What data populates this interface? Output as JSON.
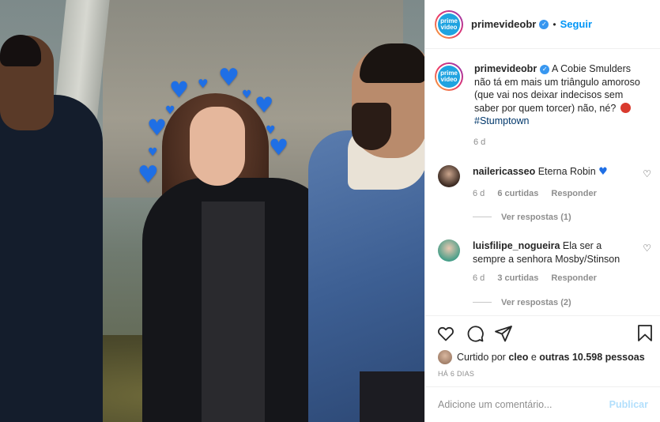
{
  "post": {
    "username": "primevideobr",
    "follow_label": "Seguir",
    "avatar_text_line1": "prime",
    "avatar_text_line2": "video"
  },
  "caption": {
    "username": "primevideobr",
    "text": "A Cobie Smulders não tá em mais um triângulo amoroso (que vai nos deixar indecisos sem saber por quem torcer) não, né?",
    "hashtag": "#Stumptown",
    "time": "6 d"
  },
  "comments": [
    {
      "username": "nailericasseo",
      "text": "Eterna Robin",
      "time": "6 d",
      "likes": "6 curtidas",
      "reply_label": "Responder",
      "view_replies": "Ver respostas (1)"
    },
    {
      "username": "luisfilipe_nogueira",
      "text": "Ela ser a sempre a senhora Mosby/Stinson",
      "time": "6 d",
      "likes": "3 curtidas",
      "reply_label": "Responder",
      "view_replies": "Ver respostas (2)"
    }
  ],
  "likes": {
    "prefix": "Curtido por",
    "user": "cleo",
    "middle": "e",
    "others": "outras 10.598 pessoas"
  },
  "time_ago": "HÁ 6 DIAS",
  "add_comment": {
    "placeholder": "Adicione um comentário...",
    "publish_label": "Publicar"
  },
  "icons": {
    "like": "heart-outline-icon",
    "comment": "comment-bubble-icon",
    "share": "paper-plane-icon",
    "save": "bookmark-icon"
  },
  "colors": {
    "link_blue": "#0095f6",
    "heart_blue": "#1f6fe5",
    "muted": "#8e8e8e"
  }
}
